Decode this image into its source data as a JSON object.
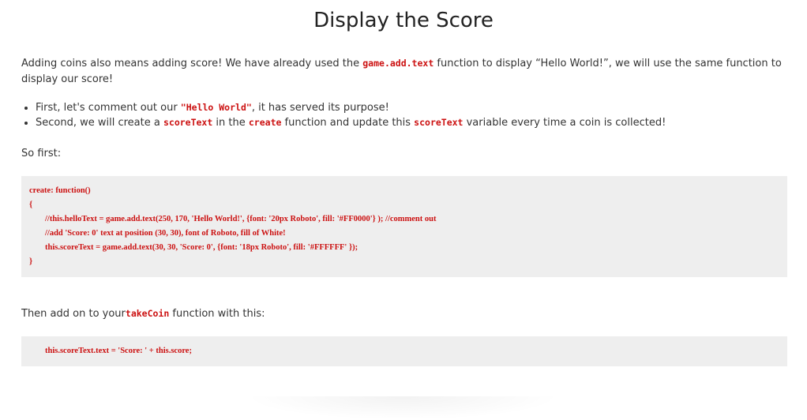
{
  "title": "Display the Score",
  "intro": {
    "part1": "Adding coins also means adding score! We have already used the ",
    "code1": "game.add.text",
    "part2": " function to display “Hello World!”, we will use the same function to display our score!"
  },
  "bullets": [
    {
      "part1": "First, let's comment out our ",
      "code1": "\"Hello World\"",
      "part2": ", it has served its purpose!"
    },
    {
      "part1": "Second, we will create a ",
      "code1": "scoreText",
      "part2": " in the ",
      "code2": "create",
      "part3": " function and update this ",
      "code3": "scoreText",
      "part4": " variable every time a coin is collected!"
    }
  ],
  "so_first": "So first:",
  "code_block_1": [
    "create: function()",
    "{",
    "//this.helloText = game.add.text(250, 170, 'Hello World!', {font: '20px Roboto', fill: '#FF0000'} ); //comment out",
    "//add 'Score: 0' text at position (30, 30), font of Roboto, fill of White!",
    "this.scoreText = game.add.text(30, 30, 'Score: 0', {font: '18px Roboto', fill: '#FFFFFF' });",
    "}"
  ],
  "then": {
    "part1": "Then add on to your",
    "code1": "takeCoin",
    "part2": " function with this:"
  },
  "code_block_2": [
    "this.scoreText.text = 'Score: ' + this.score;"
  ],
  "colors": {
    "code_text": "#cc1111",
    "code_background": "#eeeeee",
    "body_text": "#333333"
  }
}
